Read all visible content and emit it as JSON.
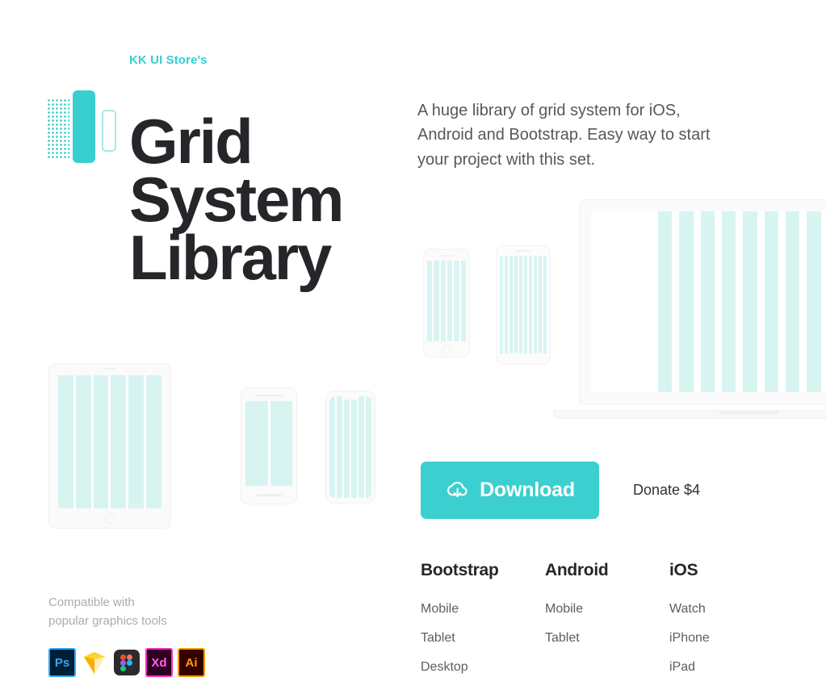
{
  "brand": {
    "kicker": "KK UI Store's",
    "logo_icon": "grid-logo-icon",
    "accent_color": "#3ACFCF",
    "heading_color": "#26262A"
  },
  "hero": {
    "title_lines": [
      "Grid",
      "System",
      "Library"
    ],
    "lede": "A huge library of grid system for iOS, Android and Bootstrap. Easy way to start your project with this set."
  },
  "cta": {
    "download_label": "Download",
    "download_icon": "cloud-download-icon",
    "download_bg": "#3BCFCF",
    "donate_label": "Donate $4"
  },
  "compatibility": {
    "note_line1": "Compatible with",
    "note_line2": "popular graphics tools",
    "tools": [
      {
        "name": "photoshop-icon",
        "label": "Ps"
      },
      {
        "name": "sketch-icon",
        "label": ""
      },
      {
        "name": "figma-icon",
        "label": ""
      },
      {
        "name": "adobe-xd-icon",
        "label": "Xd"
      },
      {
        "name": "illustrator-icon",
        "label": "Ai"
      }
    ]
  },
  "platforms": [
    {
      "title": "Bootstrap",
      "items": [
        "Mobile",
        "Tablet",
        "Desktop"
      ]
    },
    {
      "title": "Android",
      "items": [
        "Mobile",
        "Tablet"
      ]
    },
    {
      "title": "iOS",
      "items": [
        "Watch",
        "iPhone",
        "iPad"
      ]
    }
  ],
  "mockups": {
    "left": [
      {
        "name": "tablet-mockup",
        "columns": 6
      },
      {
        "name": "android-phone-mockup",
        "columns": 2
      },
      {
        "name": "iphone-x-mockup",
        "columns": 6
      }
    ],
    "right": [
      {
        "name": "iphone-8-mockup",
        "columns": 6
      },
      {
        "name": "pixel-phone-mockup",
        "columns": 10
      },
      {
        "name": "laptop-mockup",
        "columns": 12
      }
    ],
    "column_color": "#D7F4F1"
  }
}
